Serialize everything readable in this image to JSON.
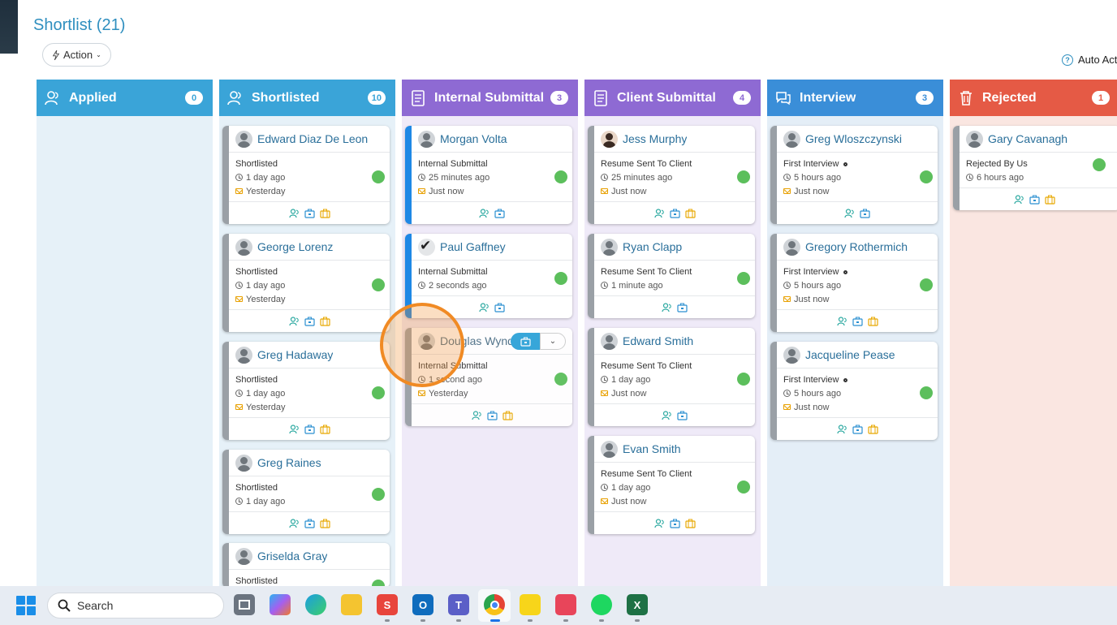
{
  "page": {
    "title": "Shortlist (21)",
    "action_label": "Action",
    "auto_action_label": "Auto Act"
  },
  "colors": {
    "applied": "#3aa4d8",
    "shortlisted": "#3aa4d8",
    "internal": "#8e6ad3",
    "client": "#8e6ad3",
    "interview": "#3a8ed8",
    "rejected": "#e55a45"
  },
  "columns": [
    {
      "id": "applied",
      "title": "Applied",
      "count": "0",
      "icon": "user-icon"
    },
    {
      "id": "shortlisted",
      "title": "Shortlisted",
      "count": "10",
      "icon": "users-icon"
    },
    {
      "id": "internal",
      "title": "Internal Submittal",
      "count": "3",
      "icon": "document-icon"
    },
    {
      "id": "client",
      "title": "Client Submittal",
      "count": "4",
      "icon": "document-icon"
    },
    {
      "id": "interview",
      "title": "Interview",
      "count": "3",
      "icon": "chat-icon"
    },
    {
      "id": "rejected",
      "title": "Rejected",
      "count": "1",
      "icon": "trash-icon"
    }
  ],
  "cards": {
    "shortlisted": [
      {
        "name": "Edward Diaz De Leon",
        "status": "Shortlisted",
        "time": "1 day ago",
        "mail": "Yesterday"
      },
      {
        "name": "George Lorenz",
        "status": "Shortlisted",
        "time": "1 day ago",
        "mail": "Yesterday"
      },
      {
        "name": "Greg Hadaway",
        "status": "Shortlisted",
        "time": "1 day ago",
        "mail": "Yesterday"
      },
      {
        "name": "Greg Raines",
        "status": "Shortlisted",
        "time": "1 day ago",
        "mail": ""
      },
      {
        "name": "Griselda Gray",
        "status": "Shortlisted",
        "time": "",
        "mail": ""
      }
    ],
    "internal": [
      {
        "name": "Morgan Volta",
        "status": "Internal Submittal",
        "time": "25 minutes ago",
        "mail": "Just now"
      },
      {
        "name": "Paul Gaffney",
        "status": "Internal Submittal",
        "time": "2 seconds ago",
        "mail": ""
      },
      {
        "name": "Douglas Wynd",
        "status": "Internal Submittal",
        "time": "1 second ago",
        "mail": "Yesterday"
      }
    ],
    "client": [
      {
        "name": "Jess Murphy",
        "status": "Resume Sent To Client",
        "time": "25 minutes ago",
        "mail": "Just now"
      },
      {
        "name": "Ryan Clapp",
        "status": "Resume Sent To Client",
        "time": "1 minute ago",
        "mail": ""
      },
      {
        "name": "Edward Smith",
        "status": "Resume Sent To Client",
        "time": "1 day ago",
        "mail": "Just now"
      },
      {
        "name": "Evan Smith",
        "status": "Resume Sent To Client",
        "time": "1 day ago",
        "mail": "Just now"
      }
    ],
    "interview": [
      {
        "name": "Greg Wloszczynski",
        "status": "First Interview",
        "time": "5 hours ago",
        "mail": "Just now"
      },
      {
        "name": "Gregory Rothermich",
        "status": "First Interview",
        "time": "5 hours ago",
        "mail": "Just now"
      },
      {
        "name": "Jacqueline Pease",
        "status": "First Interview",
        "time": "5 hours ago",
        "mail": "Just now"
      }
    ],
    "rejected": [
      {
        "name": "Gary Cavanagh",
        "status": "Rejected By Us",
        "time": "6 hours ago",
        "mail": ""
      }
    ]
  },
  "taskbar": {
    "search_placeholder": "Search"
  }
}
